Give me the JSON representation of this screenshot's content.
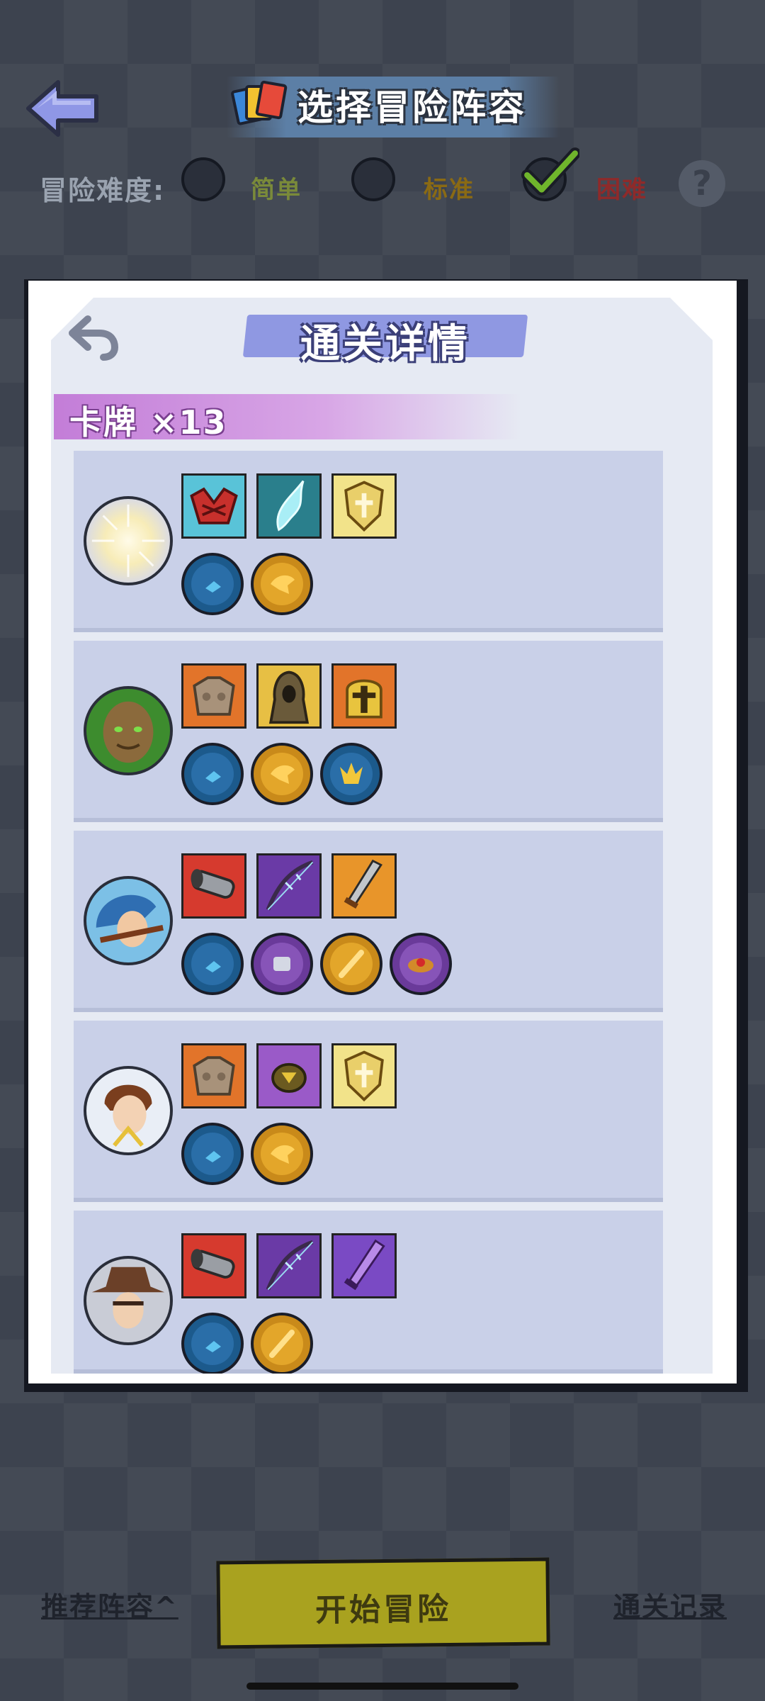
{
  "header": {
    "title": "选择冒险阵容",
    "back_icon": "back-arrow-icon"
  },
  "difficulty": {
    "label": "冒险难度:",
    "options": [
      {
        "label": "简单",
        "selected": false,
        "color": "#7a8a3a"
      },
      {
        "label": "标准",
        "selected": false,
        "color": "#8a6a14"
      },
      {
        "label": "困难",
        "selected": true,
        "color": "#8e2a2a"
      }
    ],
    "help_icon": "?"
  },
  "panel": {
    "title": "通关详情",
    "card_count": "卡牌 ×13",
    "heroes": [
      {
        "portrait": "light-burst",
        "cards": [
          "red-claw",
          "cyan-wing",
          "gold-shield"
        ],
        "gems": [
          "blue-gem",
          "gold-gem"
        ]
      },
      {
        "portrait": "tree-ent",
        "cards": [
          "stone-armor",
          "hooded-figure",
          "gold-helmet"
        ],
        "gems": [
          "blue-gem",
          "gold-gem",
          "blue-gold-gem"
        ]
      },
      {
        "portrait": "archer-blue-hood",
        "cards": [
          "red-cannon",
          "purple-bow",
          "orange-sword"
        ],
        "gems": [
          "blue-gem",
          "purple-gem",
          "gold-gem",
          "purple-gem"
        ]
      },
      {
        "portrait": "brown-hair-youth",
        "cards": [
          "stone-armor",
          "purple-beetle",
          "gold-shield"
        ],
        "gems": [
          "blue-gem",
          "gold-gem"
        ]
      },
      {
        "portrait": "cowboy-hat",
        "cards": [
          "red-cannon",
          "purple-bow",
          "purple-sword"
        ],
        "gems": [
          "blue-gem",
          "gold-gem"
        ]
      }
    ]
  },
  "footer": {
    "recommend_label": "推荐阵容^",
    "start_label": "开始冒险",
    "records_label": "通关记录"
  },
  "colors": {
    "background": "#3d434f",
    "panel": "#e6eaf3",
    "row": "#c9d0e8",
    "start_button": "#a9a21f"
  }
}
